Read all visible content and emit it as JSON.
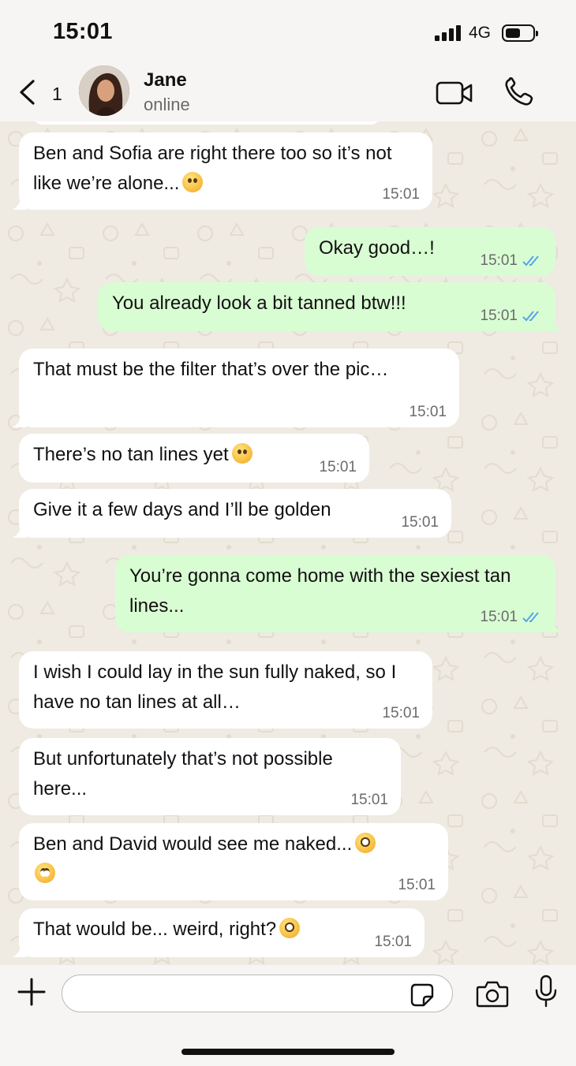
{
  "status_bar": {
    "time": "15:01",
    "network": "4G"
  },
  "header": {
    "back_count": "1",
    "contact_name": "Jane",
    "contact_status": "online",
    "icons": [
      "chevron-left-icon",
      "video-call-icon",
      "phone-icon"
    ]
  },
  "messages": [
    {
      "direction": "in",
      "text": "Ben and Sofia are right there too so it’s not like we’re alone...",
      "emoji": "sweat-smile",
      "time": "15:01"
    },
    {
      "direction": "out",
      "text": "Okay good…!",
      "time": "15:01",
      "read": true
    },
    {
      "direction": "out",
      "text": "You already look a bit tanned btw!!!",
      "time": "15:01",
      "read": true
    },
    {
      "direction": "in",
      "text": "That must be the filter that’s over the pic…",
      "time": "15:01"
    },
    {
      "direction": "in",
      "text": "There’s no tan lines yet",
      "emoji": "joy",
      "time": "15:01"
    },
    {
      "direction": "in",
      "text": "Give it a few days and I’ll be golden",
      "time": "15:01"
    },
    {
      "direction": "out",
      "text": "You’re gonna come home with the sexiest tan lines...",
      "time": "15:01",
      "read": true
    },
    {
      "direction": "in",
      "text": "I wish I could lay in the sun fully naked, so I have no tan lines at all…",
      "time": "15:01"
    },
    {
      "direction": "in",
      "text": "But unfortunately that’s not possible here...",
      "time": "15:01"
    },
    {
      "direction": "in",
      "text": "Ben and David would see me naked...",
      "emoji": "flushed, eye-roll",
      "time": "15:01"
    },
    {
      "direction": "in",
      "text": "That would be... weird, right?",
      "emoji": "flushed",
      "time": "15:01"
    }
  ],
  "composer": {
    "input_value": "",
    "icons": [
      "plus-icon",
      "sticker-icon",
      "camera-icon",
      "microphone-icon"
    ]
  },
  "colors": {
    "incoming_bubble": "#ffffff",
    "outgoing_bubble": "#d9fdd3",
    "read_ticks": "#53a6e8",
    "chat_background": "#efeae2"
  }
}
